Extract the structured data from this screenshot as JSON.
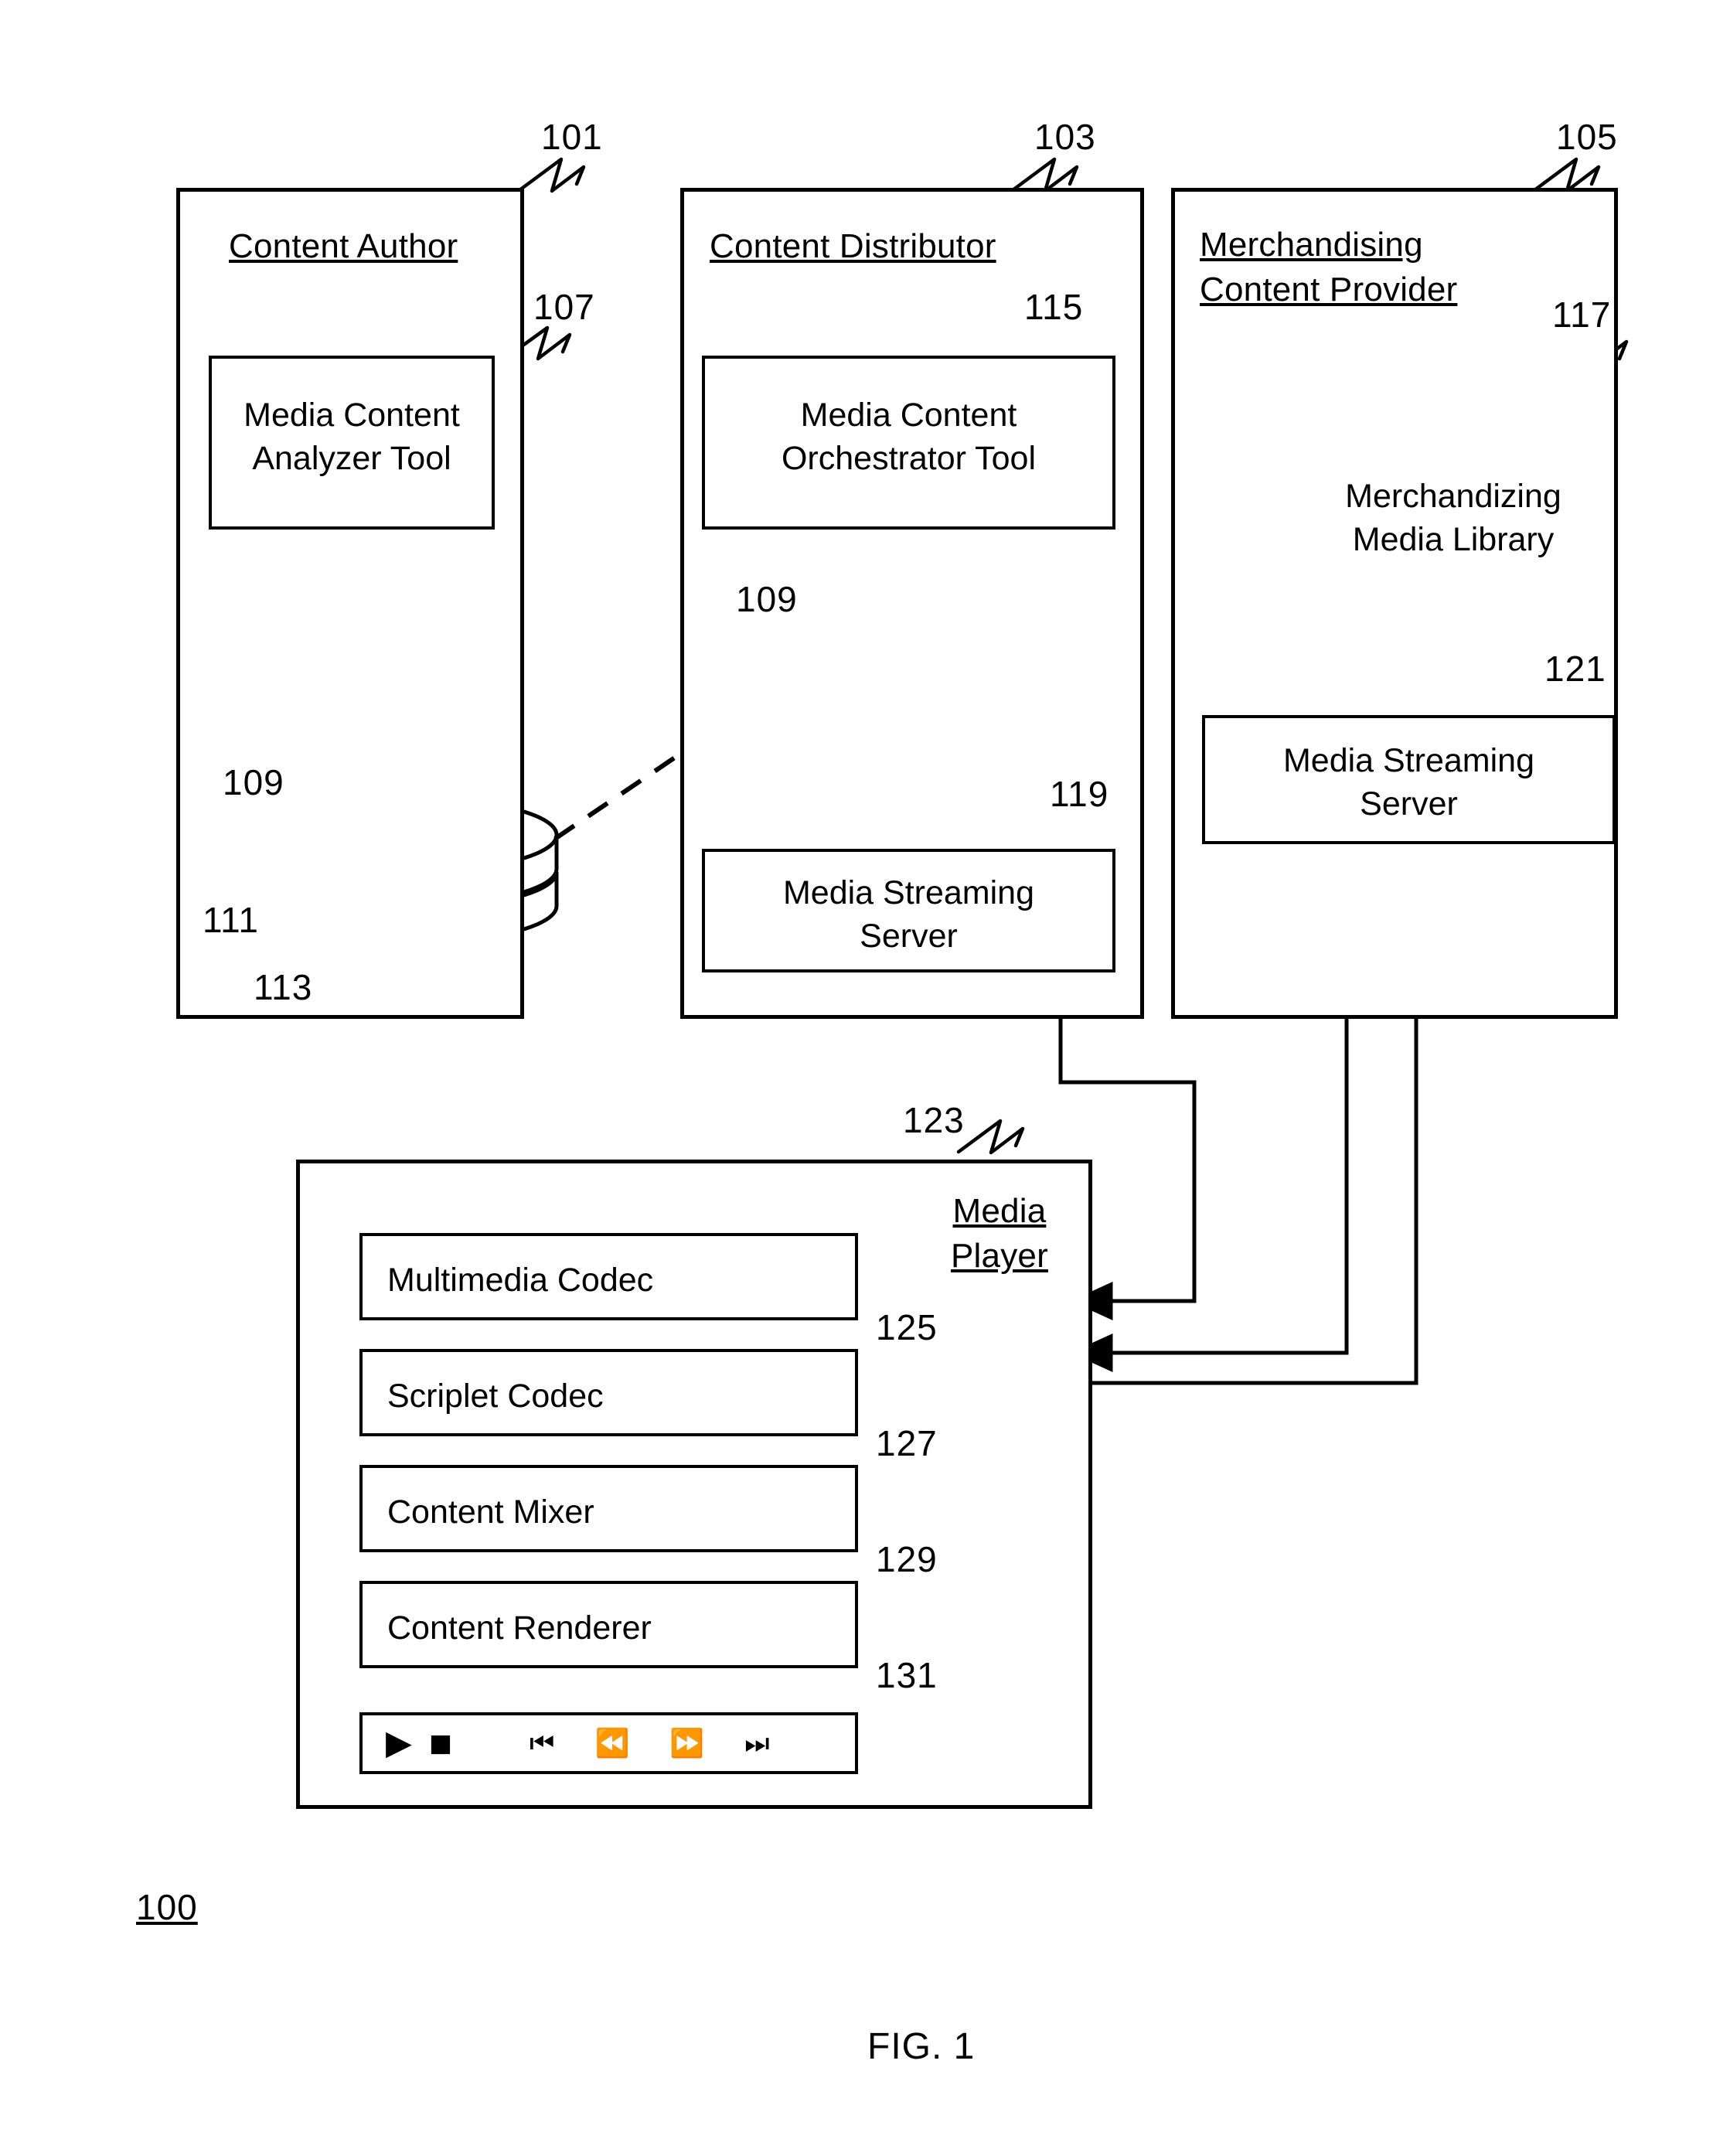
{
  "figure": {
    "caption": "FIG. 1",
    "system_number": "100"
  },
  "panels": [
    {
      "id": "content-author",
      "ref": "101",
      "title": "Content Author"
    },
    {
      "id": "content-distributor",
      "ref": "103",
      "title": "Content Distributor"
    },
    {
      "id": "merchandising-provider",
      "ref": "105",
      "title": "Merchandising\nContent Provider"
    }
  ],
  "blocks": {
    "analyzer_tool": {
      "ref": "107",
      "label": "Media Content\nAnalyzer Tool"
    },
    "orchestrator_tool": {
      "ref": "115",
      "label": "Media Content\nOrchestrator Tool"
    },
    "streaming_server_distributor": {
      "ref": "119",
      "label": "Media Streaming\nServer"
    },
    "streaming_server_merch": {
      "ref": "121",
      "label": "Media Streaming\nServer"
    },
    "media_library": {
      "ref": "117",
      "label": "Merchandizing\nMedia Library"
    }
  },
  "discs": {
    "author_stack": {
      "refs": [
        "109",
        "111",
        "113"
      ]
    },
    "distributor_disc": {
      "ref": "109"
    }
  },
  "media_player": {
    "ref": "123",
    "title": "Media\nPlayer",
    "components": [
      {
        "ref": "125",
        "label": "Multimedia Codec"
      },
      {
        "ref": "127",
        "label": "Scriplet Codec"
      },
      {
        "ref": "129",
        "label": "Content Mixer"
      },
      {
        "ref": "131",
        "label": "Content Renderer"
      }
    ],
    "controls": [
      {
        "name": "play",
        "glyph": "▶"
      },
      {
        "name": "stop",
        "glyph": "■"
      },
      {
        "name": "skip-previous",
        "glyph": "⏮"
      },
      {
        "name": "rewind",
        "glyph": "⏪"
      },
      {
        "name": "fast-forward",
        "glyph": "⏩"
      },
      {
        "name": "skip-next",
        "glyph": "⏭"
      }
    ]
  }
}
